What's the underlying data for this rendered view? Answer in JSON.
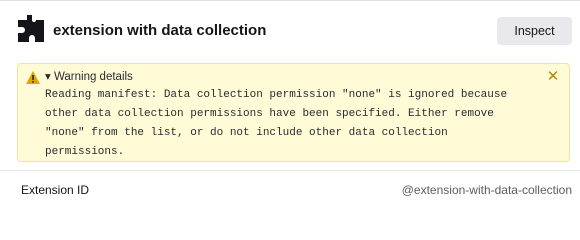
{
  "header": {
    "icon": "puzzle-piece-icon",
    "title": "extension with data collection",
    "inspect_label": "Inspect"
  },
  "warning": {
    "icon": "warning-triangle-icon",
    "summary": "▾ Warning details",
    "close_icon": "close-icon",
    "message": "Reading manifest: Data collection permission \"none\" is ignored because\nother data collection permissions have been specified. Either remove\n\"none\" from the list, or do not include other data collection\npermissions.",
    "accent_color": "#e0a600",
    "background_color": "#fffbd6"
  },
  "details": {
    "extension_id_label": "Extension ID",
    "extension_id_value": "@extension-with-data-collection"
  }
}
